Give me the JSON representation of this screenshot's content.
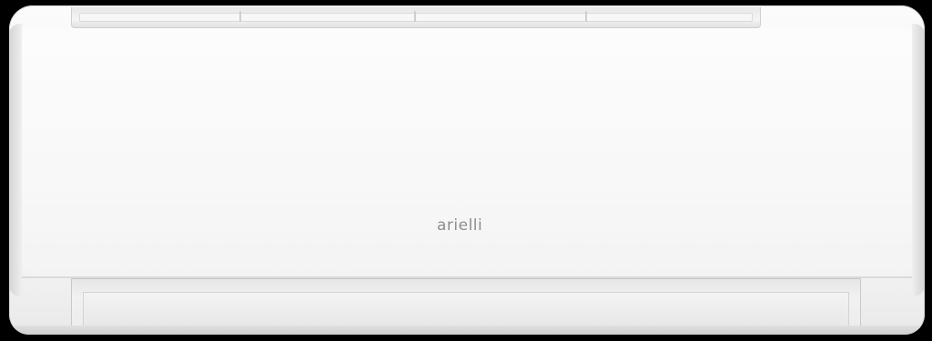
{
  "product": {
    "brand_logo": "arielli"
  },
  "colors": {
    "background": "#000000",
    "unit_body": "#f6f6f6",
    "logo_text": "#8e8e8e"
  }
}
